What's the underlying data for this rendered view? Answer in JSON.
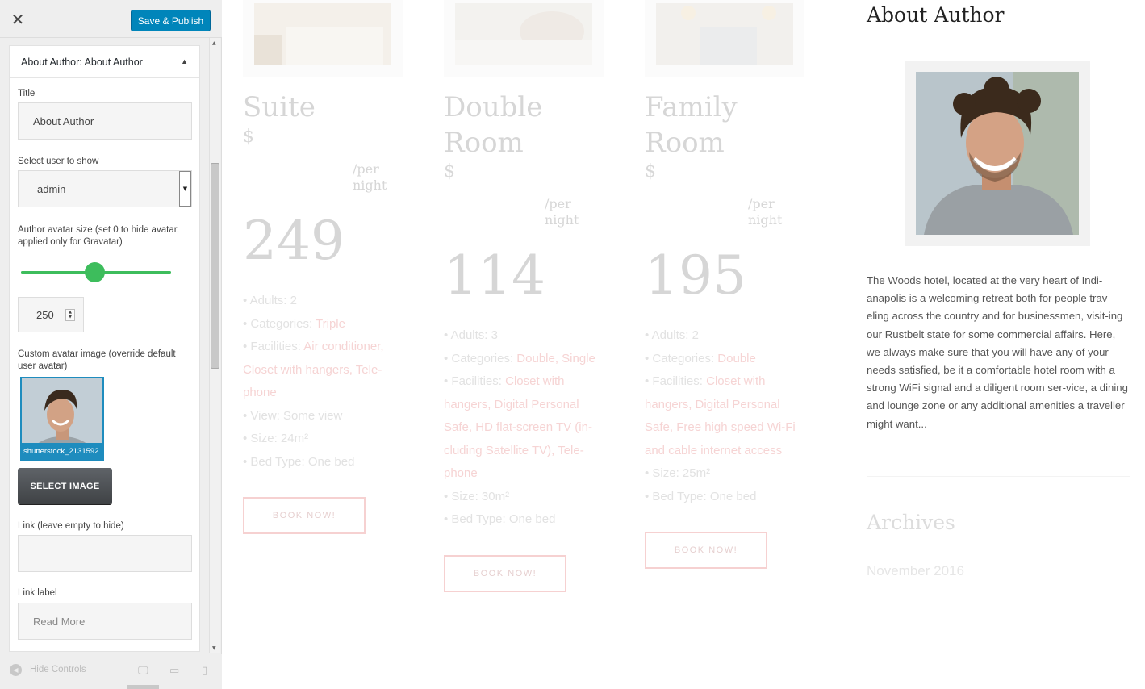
{
  "customizer": {
    "close_icon": "close-icon",
    "publish_label": "Save & Publish",
    "widget": {
      "title": "About Author: About Author",
      "title_label": "Title",
      "title_value": "About Author",
      "user_label": "Select user to show",
      "user_value": "admin",
      "size_label": "Author avatar size (set 0 to hide avatar, applied only for Gravatar)",
      "size_value": "250",
      "slider_fraction": 0.49,
      "custom_label": "Custom avatar image (override default user avatar)",
      "avatar_file": "shutterstock_2131592",
      "select_image_label": "SELECT IMAGE",
      "link_label": "Link (leave empty to hide)",
      "link_value": "",
      "link_text_label": "Link label",
      "link_text_placeholder": "Read More"
    },
    "footer": {
      "hide_label": "Hide Controls",
      "devices": [
        "desktop-icon",
        "tablet-icon",
        "mobile-icon"
      ]
    }
  },
  "rooms": [
    {
      "title_lines": [
        "Suite"
      ],
      "currency": "$",
      "per": [
        "/per",
        "night"
      ],
      "price": "249",
      "adults": "• Adults: 2",
      "categories_prefix": "• Categories: ",
      "categories": "Triple",
      "facilities_prefix": "• Facilities: ",
      "facilities": "Air conditioner, Closet with hangers, Tele-phone",
      "view": "• View: Some view",
      "size": "• Size: 24m²",
      "bed": "• Bed Type: One bed",
      "button": "BOOK NOW!"
    },
    {
      "title_lines": [
        "Double",
        "Room"
      ],
      "currency": "$",
      "per": [
        "/per",
        "night"
      ],
      "price": "114",
      "adults": "• Adults: 3",
      "categories_prefix": "• Categories: ",
      "categories": "Double, Single",
      "facilities_prefix": "• Facilities: ",
      "facilities": "Closet with hangers, Digital Personal Safe, HD flat-screen TV (in-cluding Satellite TV), Tele-phone",
      "size": "• Size: 30m²",
      "bed": "• Bed Type: One bed",
      "button": "BOOK NOW!"
    },
    {
      "title_lines": [
        "Family",
        "Room"
      ],
      "currency": "$",
      "per": [
        "/per",
        "night"
      ],
      "price": "195",
      "adults": "• Adults: 2",
      "categories_prefix": "• Categories: ",
      "categories": "Double",
      "facilities_prefix": "• Facilities: ",
      "facilities": "Closet with hangers, Digital Personal Safe, Free high speed Wi-Fi and cable internet access",
      "size": "• Size: 25m²",
      "bed": "• Bed Type: One bed",
      "button": "BOOK NOW!"
    }
  ],
  "sidebar": {
    "title": "About Author",
    "bio": "The Woods hotel, located at the very heart of Indi-anapolis is a welcoming retreat both for people trav-eling across the country and for businessmen, visit-ing our Rustbelt state for some commercial affairs. Here, we always make sure that you will have any of your needs satisfied, be it a comfortable hotel room with a strong WiFi signal and a diligent room ser-vice, a dining and lounge zone or any additional amenities a traveller might want...",
    "archives_title": "Archives",
    "archive_item": "November 2016"
  },
  "colors": {
    "accent": "#0085ba",
    "slider": "#3dbd5c",
    "book_border": "#f6d1d1"
  }
}
